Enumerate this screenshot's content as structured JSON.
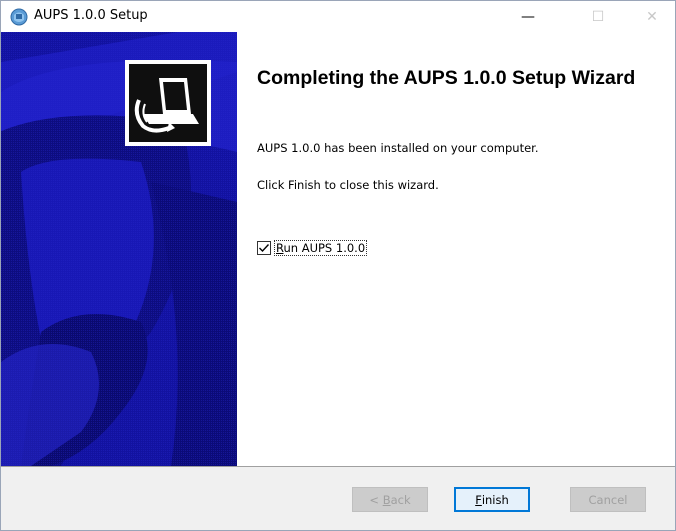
{
  "window": {
    "title": "AUPS 1.0.0 Setup",
    "minimize_glyph": "—",
    "maximize_glyph": "☐",
    "close_glyph": "✕"
  },
  "content": {
    "heading": "Completing the AUPS 1.0.0 Setup Wizard",
    "installed_text": "AUPS 1.0.0 has been installed on your computer.",
    "finish_hint": "Click Finish to close this wizard.",
    "run_checkbox": {
      "label_prefix": "",
      "label_accel": "R",
      "label_rest": "un AUPS 1.0.0",
      "checked": true
    }
  },
  "footer": {
    "back": {
      "prefix": "< ",
      "accel": "B",
      "rest": "ack",
      "enabled": false
    },
    "finish": {
      "prefix": "",
      "accel": "F",
      "rest": "inish",
      "enabled": true
    },
    "cancel": {
      "label": "Cancel",
      "enabled": false
    }
  },
  "colors": {
    "sidebar": "#1414a8",
    "accent": "#0078d7",
    "footer_bg": "#f0f0f0"
  },
  "icons": [
    "installer-app-icon",
    "setup-computer-logo-icon",
    "checkmark-icon"
  ]
}
